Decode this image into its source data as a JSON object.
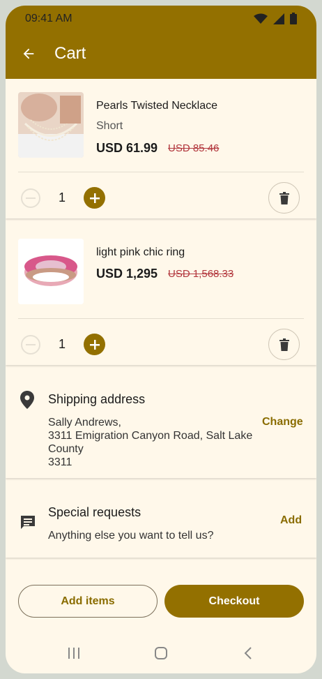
{
  "status_bar": {
    "time": "09:41 AM"
  },
  "app_bar": {
    "title": "Cart"
  },
  "cart": {
    "items": [
      {
        "name": "Pearls Twisted Necklace",
        "variant": "Short",
        "price": "USD 61.99",
        "original_price": "USD 85.46",
        "quantity": "1",
        "image": "necklace-photo"
      },
      {
        "name": "light pink chic ring",
        "price": "USD 1,295",
        "original_price": "USD 1,568.33",
        "quantity": "1",
        "image": "ring-photo"
      }
    ]
  },
  "shipping": {
    "title": "Shipping address",
    "name_line": "Sally Andrews,",
    "address_line": "3311 Emigration Canyon Road, Salt Lake County",
    "zip_line": "3311",
    "action": "Change"
  },
  "requests": {
    "title": "Special requests",
    "subtitle": "Anything else you want to tell us?",
    "action": "Add"
  },
  "footer": {
    "add_items": "Add items",
    "checkout": "Checkout"
  },
  "colors": {
    "primary": "#937000",
    "background": "#fff8ea",
    "strike_price": "#b2373d"
  },
  "icons": [
    "back-arrow-icon",
    "wifi-icon",
    "signal-icon",
    "battery-icon",
    "minus-icon",
    "plus-icon",
    "trash-icon",
    "location-pin-icon",
    "chat-icon",
    "recents-icon",
    "home-icon",
    "back-icon"
  ]
}
